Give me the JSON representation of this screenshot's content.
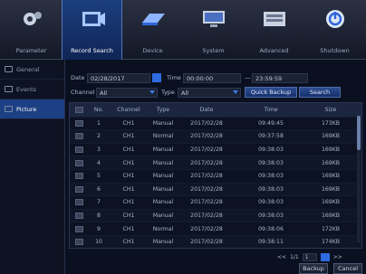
{
  "tabs": [
    {
      "label": "Parameter",
      "icon": "gear-icon",
      "active": false
    },
    {
      "label": "Record Search",
      "icon": "video-camera-icon",
      "active": true
    },
    {
      "label": "Device",
      "icon": "hard-disk-icon",
      "active": false
    },
    {
      "label": "System",
      "icon": "monitor-icon",
      "active": false
    },
    {
      "label": "Advanced",
      "icon": "keyboard-icon",
      "active": false
    },
    {
      "label": "Shutdown",
      "icon": "power-icon",
      "active": false
    }
  ],
  "sidebar": {
    "items": [
      {
        "label": "General",
        "active": false
      },
      {
        "label": "Events",
        "active": false
      },
      {
        "label": "Picture",
        "active": true
      }
    ]
  },
  "filters": {
    "date_label": "Date",
    "date_value": "02/28/2017",
    "time_label": "Time",
    "time_start": "00:00:00",
    "time_separator": "—",
    "time_end": "23:59:59",
    "channel_label": "Channel",
    "channel_value": "All",
    "type_label": "Type",
    "type_value": "All",
    "quick_backup_label": "Quick Backup",
    "search_label": "Search"
  },
  "table": {
    "headers": [
      "No.",
      "Channel",
      "Type",
      "Date",
      "Time",
      "Size"
    ],
    "rows": [
      [
        "1",
        "CH1",
        "Manual",
        "2017/02/28",
        "09:49:45",
        "173KB"
      ],
      [
        "2",
        "CH1",
        "Normal",
        "2017/02/28",
        "09:37:58",
        "169KB"
      ],
      [
        "3",
        "CH1",
        "Manual",
        "2017/02/28",
        "09:38:03",
        "169KB"
      ],
      [
        "4",
        "CH1",
        "Manual",
        "2017/02/28",
        "09:38:03",
        "169KB"
      ],
      [
        "5",
        "CH1",
        "Manual",
        "2017/02/28",
        "09:38:03",
        "169KB"
      ],
      [
        "6",
        "CH1",
        "Manual",
        "2017/02/28",
        "09:38:03",
        "169KB"
      ],
      [
        "7",
        "CH1",
        "Manual",
        "2017/02/28",
        "09:38:03",
        "169KB"
      ],
      [
        "8",
        "CH1",
        "Manual",
        "2017/02/28",
        "09:38:03",
        "169KB"
      ],
      [
        "9",
        "CH1",
        "Normal",
        "2017/02/28",
        "09:38:06",
        "172KB"
      ],
      [
        "10",
        "CH1",
        "Manual",
        "2017/02/28",
        "09:38:11",
        "174KB"
      ]
    ]
  },
  "pager": {
    "prev": "<<",
    "page_text": "1/1",
    "page_input": "1",
    "next": ">>"
  },
  "actions": {
    "backup_label": "Backup",
    "cancel_label": "Cancel"
  }
}
